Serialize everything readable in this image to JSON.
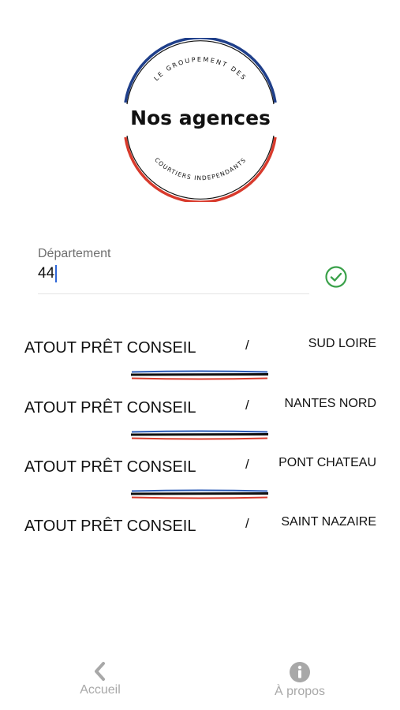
{
  "logo": {
    "title": "Nos agences",
    "arc_top": "LE GROUPEMENT DES",
    "arc_bottom": "COURTIERS INDEPENDANTS"
  },
  "form": {
    "label": "Département",
    "value": "44",
    "valid_icon": "check-circle-icon"
  },
  "agencies": [
    {
      "name": "ATOUT PRÊT CONSEIL",
      "separator": "/",
      "location": "SUD LOIRE"
    },
    {
      "name": "ATOUT PRÊT CONSEIL",
      "separator": "/",
      "location": "NANTES NORD"
    },
    {
      "name": "ATOUT PRÊT CONSEIL",
      "separator": "/",
      "location": "PONT CHATEAU"
    },
    {
      "name": "ATOUT PRÊT CONSEIL",
      "separator": "/",
      "location": "SAINT NAZAIRE"
    }
  ],
  "tabbar": {
    "back_label": "Accueil",
    "back_icon": "chevron-left-icon",
    "about_label": "À propos",
    "about_icon": "info-icon"
  },
  "colors": {
    "brand_blue": "#1f3f8a",
    "brand_red": "#d83a2c",
    "valid_green": "#3aa14a",
    "muted_gray": "#a8a8a8"
  }
}
